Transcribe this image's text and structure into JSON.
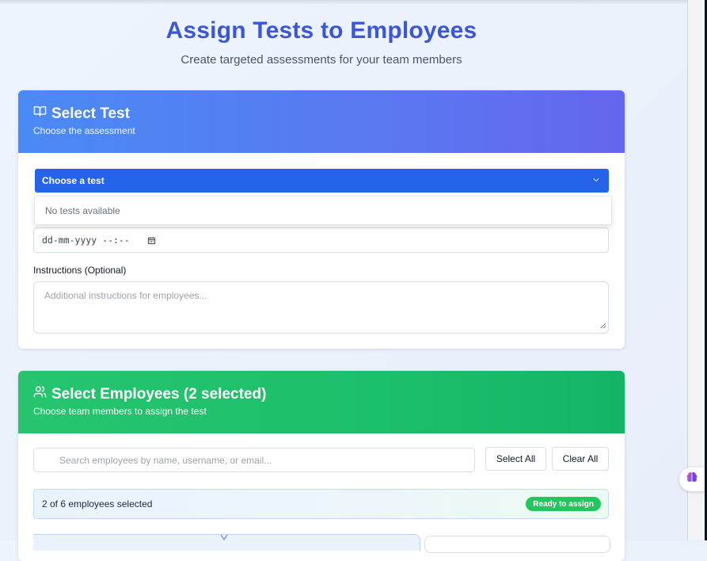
{
  "header": {
    "title": "Assign Tests to Employees",
    "subtitle": "Create targeted assessments for your team members"
  },
  "select_test": {
    "title": "Select Test",
    "subtitle": "Choose the assessment",
    "icon": "book-open-icon",
    "dropdown": {
      "selected_label": "Choose a test",
      "empty_option": "No tests available"
    },
    "due_date": {
      "placeholder": "dd-mm-yyyy --:--"
    },
    "instructions": {
      "label": "Instructions (Optional)",
      "placeholder": "Additional instructions for employees..."
    }
  },
  "select_employees": {
    "title": "Select Employees (2 selected)",
    "subtitle": "Choose team members to assign the test",
    "icon": "users-icon",
    "search": {
      "placeholder": "Search employees by name, username, or email..."
    },
    "select_all_label": "Select All",
    "clear_all_label": "Clear All",
    "summary": {
      "text": "2 of 6 employees selected",
      "badge": "Ready to assign"
    }
  },
  "colors": {
    "title_blue": "#3b56d6",
    "test_header_start": "#4a8af5",
    "test_header_end": "#6466ee",
    "dropdown_blue": "#2563eb",
    "employees_header": "#1cbf6b",
    "ready_badge": "#22c55e"
  }
}
